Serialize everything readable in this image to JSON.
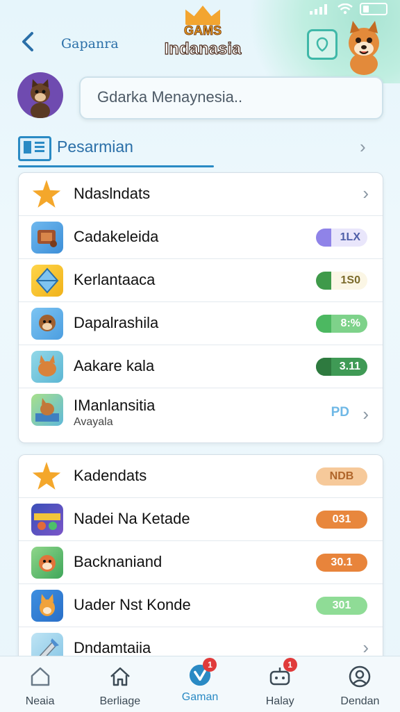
{
  "status": {
    "wifi_icon": "wifi-icon",
    "signal_icon": "signal-icon"
  },
  "header": {
    "back_label": "Gapanra",
    "logo_top": "GAMS",
    "logo_name": "Indanasia"
  },
  "search": {
    "placeholder": "Gdarka Menaynesia.."
  },
  "section": {
    "label": "Pesarmian"
  },
  "card1": {
    "header": {
      "title": "Ndaslndats"
    },
    "items": [
      {
        "title": "Cadakeleida",
        "badge": "1LX",
        "badge_bg": "#e9e6fb",
        "badge_fg": "#4e5ea8",
        "dot": "#8f83e8"
      },
      {
        "title": "Kerlantaaca",
        "badge": "1S0",
        "badge_bg": "#fbf6e5",
        "badge_fg": "#7a6a2a",
        "dot": "#3f9a4a"
      },
      {
        "title": "Dapalrashila",
        "badge": "8:%",
        "badge_bg": "#7ed28a",
        "badge_fg": "#ffffff",
        "dot": "#4cb861"
      },
      {
        "title": "Aakare kala",
        "badge": "3.11",
        "badge_bg": "#3f9a55",
        "badge_fg": "#ffffff",
        "dot": "#2e7a3f"
      },
      {
        "title": "IManlansitia",
        "subtitle": "Avayala",
        "tag": "PD"
      }
    ]
  },
  "card2": {
    "header": {
      "title": "Kadendats",
      "badge": "NDB"
    },
    "items": [
      {
        "title": "Nadei Na Ketade",
        "badge": "031",
        "badge_bg": "#e8873d"
      },
      {
        "title": "Backnaniand",
        "badge": "30.1",
        "badge_bg": "#e8843b"
      },
      {
        "title": "Uader Nst Konde",
        "badge": "301",
        "badge_bg": "#8fdc96"
      },
      {
        "title": "Dndamtaiia"
      }
    ]
  },
  "nav": {
    "items": [
      {
        "label": "Neaia",
        "icon": "home-icon"
      },
      {
        "label": "Berliage",
        "icon": "home-outline-icon"
      },
      {
        "label": "Gaman",
        "icon": "check-circle-icon",
        "badge": "1"
      },
      {
        "label": "Halay",
        "icon": "gamepad-icon",
        "badge": "1"
      },
      {
        "label": "Dendan",
        "icon": "profile-icon"
      }
    ]
  },
  "colors": {
    "accent": "#2a8ac4",
    "teal": "#3fb8a8",
    "star": "#f4a72b"
  }
}
